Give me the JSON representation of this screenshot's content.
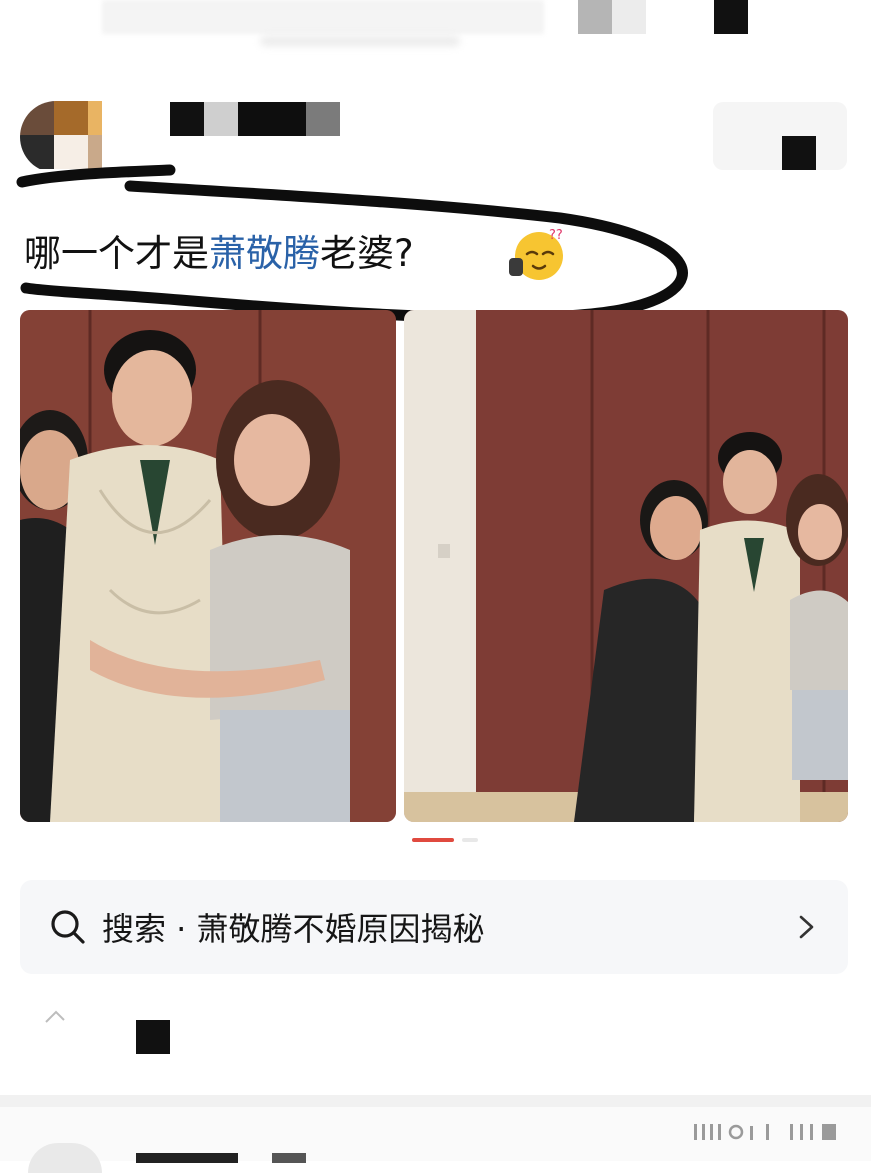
{
  "post": {
    "text_before": "哪一个才是",
    "mention": "萧敬腾",
    "text_after": "老婆?",
    "emoji": "dizzy-face-emoji"
  },
  "search": {
    "prefix": "搜索 · ",
    "query": "萧敬腾不婚原因揭秘"
  },
  "colors": {
    "mention": "#2a62a8",
    "indicator_active": "#e04a3f"
  },
  "icons": {
    "search": "search-icon",
    "chevron": "chevron-right-icon"
  }
}
